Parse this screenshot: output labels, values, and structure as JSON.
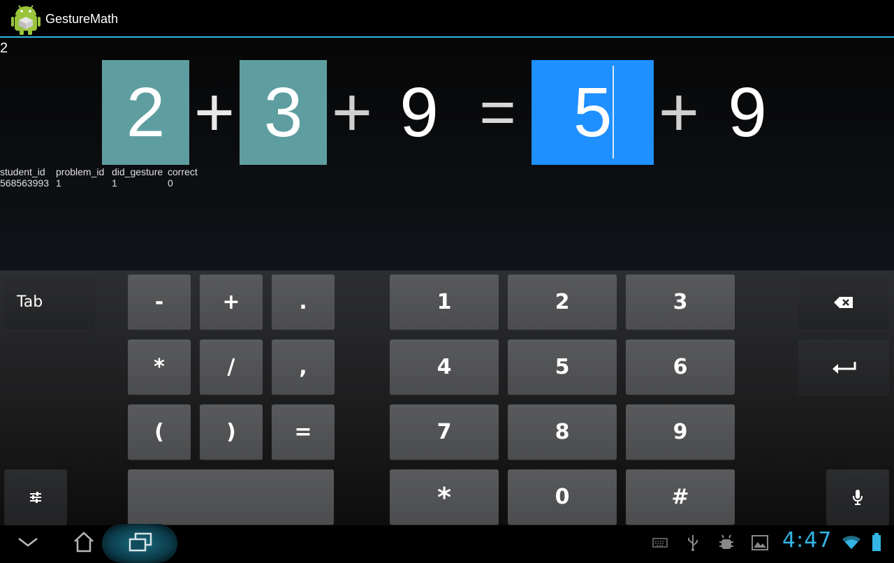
{
  "app": {
    "title": "GestureMath"
  },
  "content": {
    "counter": "2",
    "equation": {
      "left_box_1": "2",
      "plus_1": "+",
      "left_box_2": "3",
      "plus_2": "+",
      "left_term_3": "9",
      "equals": "=",
      "answer": "5",
      "plus_3": "+",
      "right_term": "9"
    },
    "log": {
      "headers": [
        "student_id",
        "problem_id",
        "did_gesture",
        "correct"
      ],
      "values": [
        "568563993",
        "1",
        "1",
        "0"
      ]
    }
  },
  "keyboard": {
    "tab": "Tab",
    "minus": "-",
    "plus": "+",
    "dot": ".",
    "star": "*",
    "slash": "/",
    "comma": ",",
    "lparen": "(",
    "rparen": ")",
    "equal": "=",
    "k1": "1",
    "k2": "2",
    "k3": "3",
    "k4": "4",
    "k5": "5",
    "k6": "6",
    "k7": "7",
    "k8": "8",
    "k9": "9",
    "kstar": "*",
    "k0": "0",
    "khash": "#",
    "icons": {
      "backspace": "backspace-icon",
      "enter": "enter-icon",
      "settings": "settings-sliders-icon",
      "mic": "microphone-icon"
    }
  },
  "navbar": {
    "clock": "4:47",
    "accent": "#33b5e5",
    "icons": [
      "back-icon",
      "home-icon",
      "recents-icon",
      "keyboard-icon",
      "usb-icon",
      "debug-icon",
      "gallery-icon",
      "wifi-icon",
      "battery-icon"
    ]
  },
  "colors": {
    "equation_box": "#5f9ea0",
    "answer_box": "#1e90ff",
    "holo_blue": "#33b5e5"
  }
}
